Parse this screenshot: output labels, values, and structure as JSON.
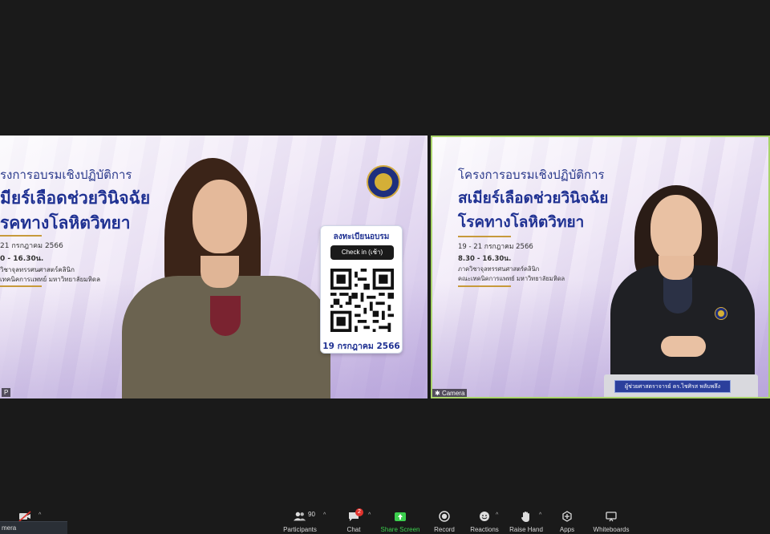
{
  "slide": {
    "title_line1": "โครงการอบรมเชิงปฏิบัติการ",
    "title_line2": "สเมียร์เลือดช่วยวินิจฉัย",
    "title_line3": "โรคทางโลหิตวิทยา",
    "dates": "19 - 21 กรกฎาคม 2566",
    "time": "8.30 - 16.30น.",
    "dept": "ภาควิชาจุลทรรศนศาสตร์คลินิก",
    "faculty": "คณะเทคนิคการแพทย์ มหาวิทยาลัยมหิดล"
  },
  "left_slide": {
    "title_line1": "รงการอบรมเชิงปฏิบัติการ",
    "title_line2": "มียร์เลือดช่วยวินิจฉัย",
    "title_line3": "รคทางโลหิตวิทยา",
    "dates": "21 กรกฎาคม 2566",
    "time": "0 - 16.30น.",
    "dept": "วิชาจุลทรรศนศาสตร์คลินิก",
    "faculty": "เทคนิคการแพทย์ มหาวิทยาลัยมหิดล"
  },
  "qr": {
    "title": "ลงทะเบียนอบรม",
    "checkin": "Check in (เช้า)",
    "date": "19 กรกฎาคม 2566"
  },
  "tiles": {
    "left_name": "P",
    "right_name": "Camera",
    "nameplate": "ผู้ช่วยศาสตราจารย์ ดร.ไชศิรส พลับพลึง"
  },
  "toolbar": {
    "participants_count": "90",
    "participants": "Participants",
    "chat_badge": "2",
    "chat": "Chat",
    "share": "Share Screen",
    "record": "Record",
    "reactions": "Reactions",
    "raise_hand": "Raise Hand",
    "apps": "Apps",
    "whiteboards": "Whiteboards",
    "camera_menu": "mera"
  },
  "colors": {
    "toolbar_bg": "#1a1a1a",
    "active_speaker_border": "#a9d46b",
    "share_green": "#3ccf4e",
    "badge_red": "#e0322c",
    "title_blue": "#1f3192"
  }
}
